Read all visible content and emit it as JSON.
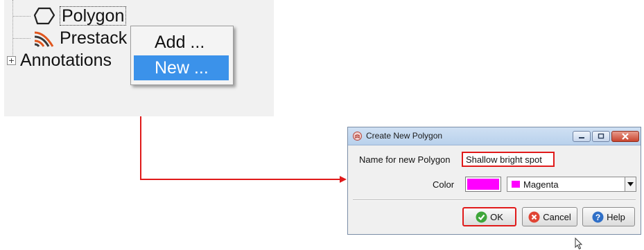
{
  "tree": {
    "items": [
      {
        "label": "Polygon",
        "icon": "polygon-icon"
      },
      {
        "label": "Prestack",
        "icon": "prestack-icon"
      },
      {
        "label": "Annotations",
        "expander": "+"
      }
    ]
  },
  "context_menu": {
    "items": [
      {
        "label": "Add ..."
      },
      {
        "label": "New ..."
      }
    ]
  },
  "dialog": {
    "title": "Create New Polygon",
    "name_label": "Name for new Polygon",
    "name_value": "Shallow bright spot",
    "color_label": "Color",
    "color_value": "Magenta",
    "color_hex": "#ff00ff",
    "buttons": {
      "ok": "OK",
      "cancel": "Cancel",
      "help": "Help"
    }
  },
  "colors": {
    "highlight": "#3b92ea",
    "annotation_red": "#e01a1a"
  }
}
